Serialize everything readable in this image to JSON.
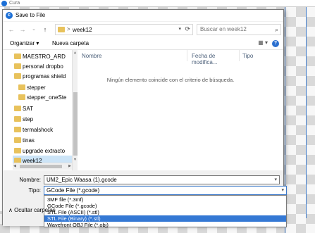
{
  "app": {
    "title": "Cura"
  },
  "dialog": {
    "title": "Save to File",
    "nav": {
      "back": "←",
      "forward": "→",
      "down": "⌄",
      "up": "↑"
    },
    "address": {
      "separator": ">",
      "current": "week12"
    },
    "search": {
      "placeholder": "Buscar en week12"
    },
    "commands": {
      "organize": "Organizar ▾",
      "new_folder": "Nueva carpeta",
      "view": "▦ ▾"
    },
    "tree": [
      {
        "label": "MAESTRO_ARD"
      },
      {
        "label": "personal dropbo"
      },
      {
        "label": "programas shield"
      },
      {
        "label": "stepper"
      },
      {
        "label": "stepper_oneSte"
      },
      {
        "label": "SAT"
      },
      {
        "label": "step"
      },
      {
        "label": "termalshock"
      },
      {
        "label": "tinas"
      },
      {
        "label": "upgrade extracto"
      },
      {
        "label": "week12",
        "selected": true
      }
    ],
    "columns": [
      "Nombre",
      "Fecha de modifica...",
      "Tipo"
    ],
    "empty_message": "Ningún elemento coincide con el criterio de búsqueda.",
    "name_label": "Nombre:",
    "name_value": "UM2_Epic Waasa (1).gcode",
    "type_label": "Tipo:",
    "type_value": "GCode File (*.gcode)",
    "type_options": [
      {
        "label": "3MF file (*.3mf)"
      },
      {
        "label": "GCode File (*.gcode)"
      },
      {
        "label": "STL File (ASCII) (*.stl)"
      },
      {
        "label": "STL File (Binary) (*.stl)",
        "selected": true
      },
      {
        "label": "Wavefront OBJ File (*.obj)"
      }
    ],
    "hide_folders": "∧ Ocultar carpetas"
  }
}
